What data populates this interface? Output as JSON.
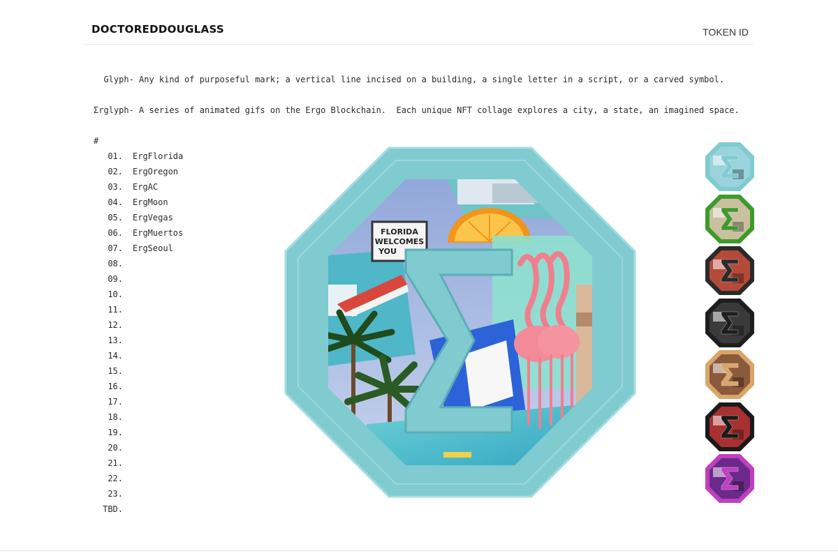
{
  "header": {
    "logo": "DOCTOREDDOUGLASS",
    "token_id_label": "TOKEN ID"
  },
  "definitions": {
    "glyph": "  Glyph- Any kind of purposeful mark; a vertical line incised on a building, a single letter in a script, or a carved symbol.",
    "erglyph": "Σrglyph- A series of animated gifs on the Ergo Blockchain.  Each unique NFT collage explores a city, a state, an imagined space."
  },
  "list_header": "#",
  "tokens": [
    {
      "num": "01.",
      "name": "ErgFlorida"
    },
    {
      "num": "02.",
      "name": "ErgOregon"
    },
    {
      "num": "03.",
      "name": "ErgAC"
    },
    {
      "num": "04.",
      "name": "ErgMoon"
    },
    {
      "num": "05.",
      "name": "ErgVegas"
    },
    {
      "num": "06.",
      "name": "ErgMuertos"
    },
    {
      "num": "07.",
      "name": "ErgSeoul"
    },
    {
      "num": "08.",
      "name": ""
    },
    {
      "num": "09.",
      "name": ""
    },
    {
      "num": "10.",
      "name": ""
    },
    {
      "num": "11.",
      "name": ""
    },
    {
      "num": "12.",
      "name": ""
    },
    {
      "num": "13.",
      "name": ""
    },
    {
      "num": "14.",
      "name": ""
    },
    {
      "num": "15.",
      "name": ""
    },
    {
      "num": "16.",
      "name": ""
    },
    {
      "num": "17.",
      "name": ""
    },
    {
      "num": "18.",
      "name": ""
    },
    {
      "num": "19.",
      "name": ""
    },
    {
      "num": "20.",
      "name": ""
    },
    {
      "num": "21.",
      "name": ""
    },
    {
      "num": "22.",
      "name": ""
    },
    {
      "num": "23.",
      "name": ""
    },
    {
      "num": "TBD.",
      "name": ""
    }
  ],
  "main_art": {
    "sign_text": "FLORIDA WELCOMES YOU",
    "frame_color": "#7fcbd0",
    "symbol": "Σ"
  },
  "thumbnails": [
    {
      "name": "ErgFlorida",
      "frame_color": "#7fcbd0",
      "fill_color": "#9ad3dc"
    },
    {
      "name": "ErgOregon",
      "frame_color": "#3f9a2c",
      "fill_color": "#c9c0a0"
    },
    {
      "name": "ErgAC",
      "frame_color": "#2a2a2a",
      "fill_color": "#b44a3a"
    },
    {
      "name": "ErgMoon",
      "frame_color": "#1e1e1e",
      "fill_color": "#3a3a3a"
    },
    {
      "name": "ErgVegas",
      "frame_color": "#d9a56a",
      "fill_color": "#8a5a3a"
    },
    {
      "name": "ErgMuertos",
      "frame_color": "#1a1a1a",
      "fill_color": "#a83030"
    },
    {
      "name": "ErgSeoul",
      "frame_color": "#c03fc0",
      "fill_color": "#6b2a8a"
    }
  ]
}
